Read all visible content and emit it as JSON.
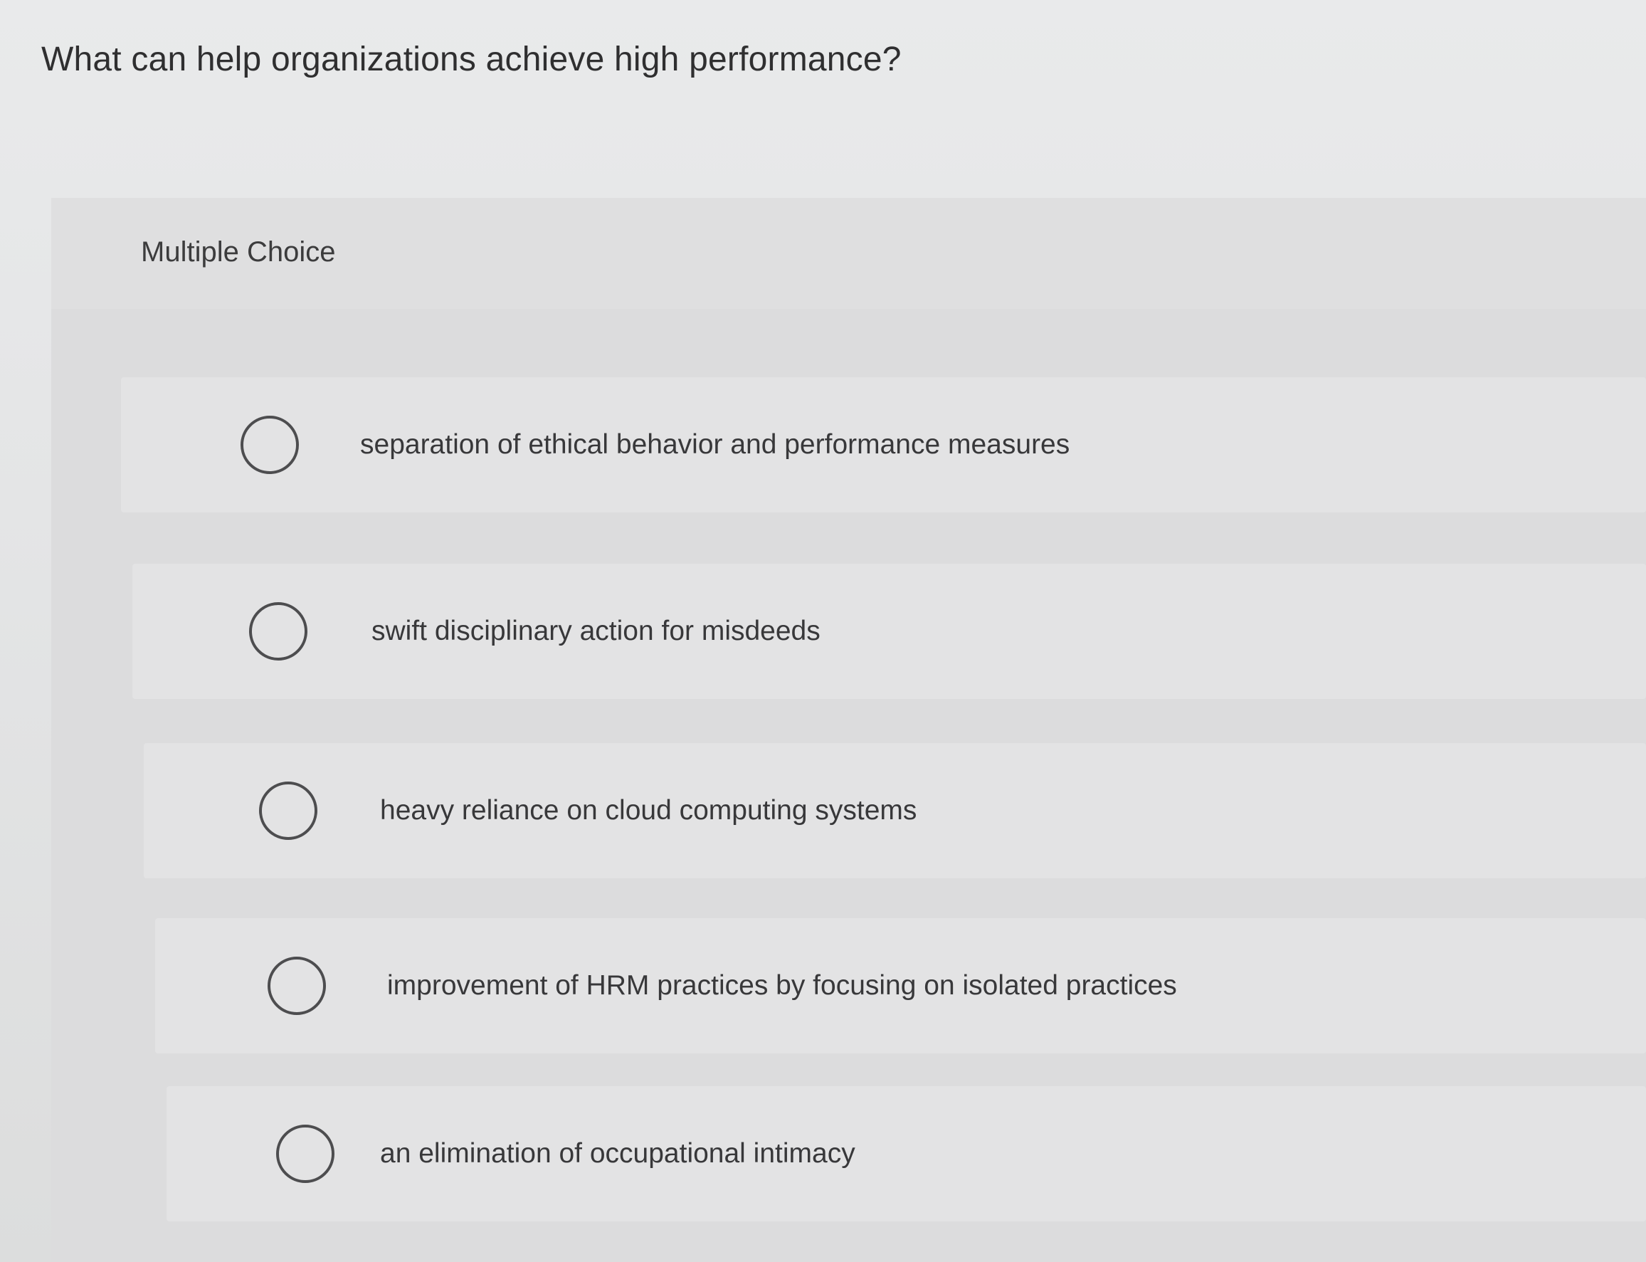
{
  "question": {
    "text": "What can help organizations achieve high performance?",
    "type_label": "Multiple Choice"
  },
  "choices": [
    {
      "label": "separation of ethical behavior and performance measures",
      "selected": false
    },
    {
      "label": "swift disciplinary action for misdeeds",
      "selected": false
    },
    {
      "label": "heavy reliance on cloud computing systems",
      "selected": false
    },
    {
      "label": "improvement of HRM practices by focusing on isolated practices",
      "selected": false
    },
    {
      "label": "an elimination of occupational intimacy",
      "selected": false
    }
  ],
  "icons": {
    "radio": "radio-button-empty-icon"
  },
  "colors": {
    "background": "#e6e7e8",
    "panel": "#dcdcdd",
    "choice_background": "#e3e3e4",
    "text": "#38383a",
    "radio_border": "#4d4d4f"
  }
}
